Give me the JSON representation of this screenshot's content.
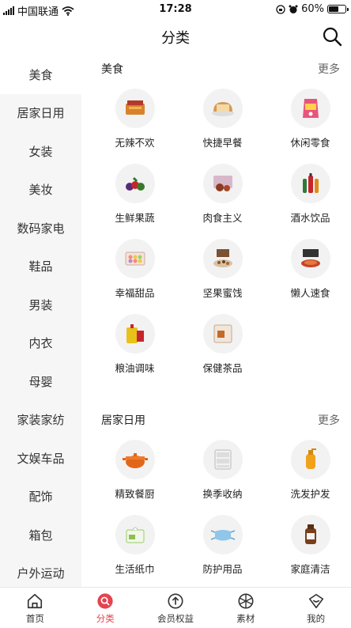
{
  "status_bar": {
    "carrier": "中国联通",
    "time": "17:28",
    "battery": "60%",
    "battery_level": 0.6
  },
  "header": {
    "title": "分类"
  },
  "sidebar": {
    "items": [
      {
        "label": "美食",
        "active": true
      },
      {
        "label": "居家日用"
      },
      {
        "label": "女装"
      },
      {
        "label": "美妆"
      },
      {
        "label": "数码家电"
      },
      {
        "label": "鞋品"
      },
      {
        "label": "男装"
      },
      {
        "label": "内衣"
      },
      {
        "label": "母婴"
      },
      {
        "label": "家装家纺"
      },
      {
        "label": "文娱车品"
      },
      {
        "label": "配饰"
      },
      {
        "label": "箱包"
      },
      {
        "label": "户外运动"
      }
    ]
  },
  "sections": [
    {
      "title": "美食",
      "more": "更多",
      "items": [
        {
          "label": "无辣不欢",
          "icon": "spicy-snack-icon"
        },
        {
          "label": "快捷早餐",
          "icon": "bread-icon"
        },
        {
          "label": "休闲零食",
          "icon": "snack-bag-icon"
        },
        {
          "label": "生鲜果蔬",
          "icon": "fruit-icon"
        },
        {
          "label": "肉食主义",
          "icon": "meat-icon"
        },
        {
          "label": "酒水饮品",
          "icon": "drinks-icon"
        },
        {
          "label": "幸福甜品",
          "icon": "dessert-icon"
        },
        {
          "label": "坚果蜜饯",
          "icon": "nuts-icon"
        },
        {
          "label": "懒人速食",
          "icon": "instant-food-icon"
        },
        {
          "label": "粮油调味",
          "icon": "cooking-oil-icon"
        },
        {
          "label": "保健茶品",
          "icon": "tea-icon"
        }
      ]
    },
    {
      "title": "居家日用",
      "more": "更多",
      "items": [
        {
          "label": "精致餐厨",
          "icon": "cooking-pot-icon"
        },
        {
          "label": "换季收纳",
          "icon": "storage-drawer-icon"
        },
        {
          "label": "洗发护发",
          "icon": "shampoo-icon"
        },
        {
          "label": "生活纸巾",
          "icon": "tissue-icon"
        },
        {
          "label": "防护用品",
          "icon": "face-mask-icon"
        },
        {
          "label": "家庭清洁",
          "icon": "disinfectant-icon"
        }
      ]
    }
  ],
  "tabs": [
    {
      "label": "首页",
      "icon": "home-icon"
    },
    {
      "label": "分类",
      "icon": "category-icon",
      "active": true
    },
    {
      "label": "会员权益",
      "icon": "member-icon"
    },
    {
      "label": "素材",
      "icon": "material-icon"
    },
    {
      "label": "我的",
      "icon": "profile-icon"
    }
  ],
  "colors": {
    "accent": "#e4434f",
    "sidebar_bg": "#f6f6f6"
  }
}
